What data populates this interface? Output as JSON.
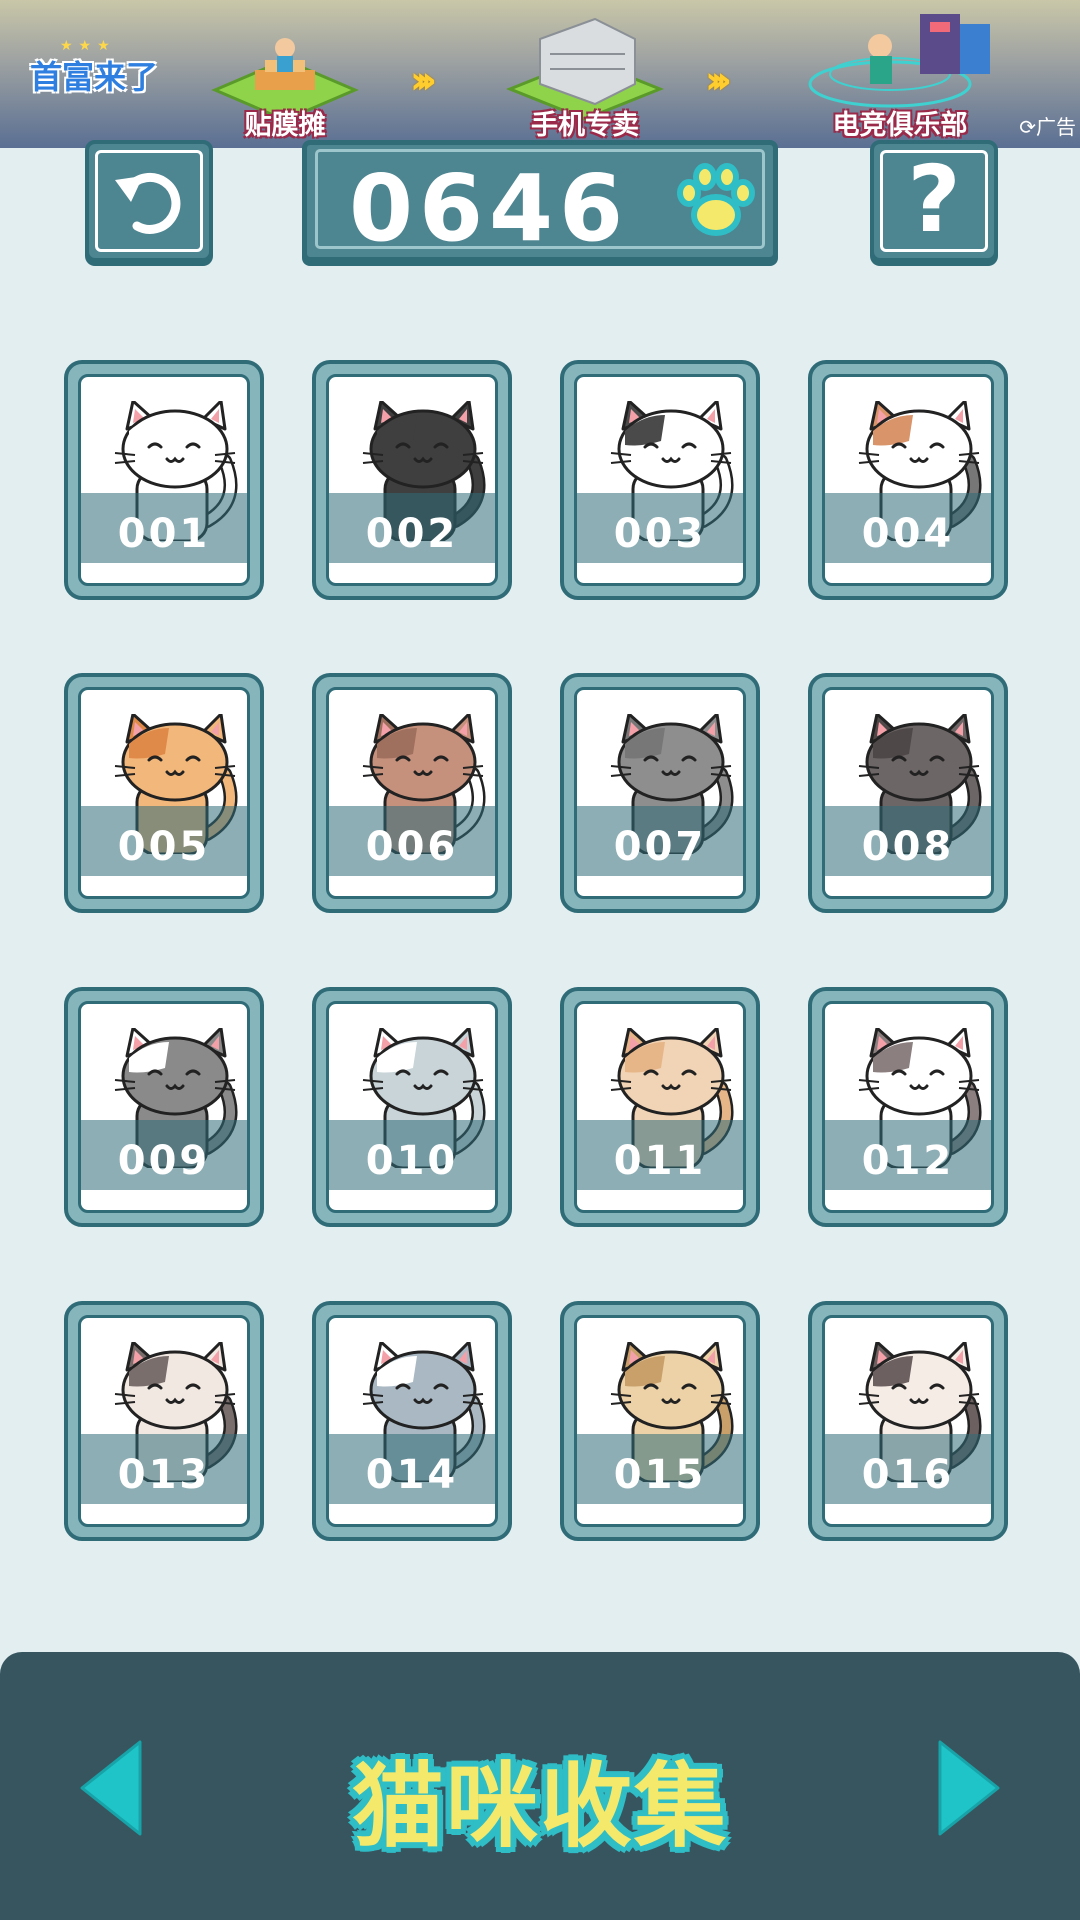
{
  "ad": {
    "logo": "首富来了",
    "stages": [
      "贴膜摊",
      "手机专卖",
      "电竞俱乐部"
    ],
    "arrow": "›››",
    "tag": "⟳广告"
  },
  "top_bar": {
    "paw_count": "0646",
    "help_label": "?",
    "undo_glyph": "↺"
  },
  "cats": [
    {
      "id": "001",
      "body": "#ffffff",
      "accent": "#ffffff",
      "tail": "#ffffff"
    },
    {
      "id": "002",
      "body": "#3f3f3f",
      "accent": "#3f3f3f",
      "tail": "#3f3f3f"
    },
    {
      "id": "003",
      "body": "#ffffff",
      "accent": "#4a4a4a",
      "tail": "#ffffff"
    },
    {
      "id": "004",
      "body": "#ffffff",
      "accent": "#d9946a",
      "tail": "#777777"
    },
    {
      "id": "005",
      "body": "#f2b77a",
      "accent": "#e08a4a",
      "tail": "#f2b77a"
    },
    {
      "id": "006",
      "body": "#c6917c",
      "accent": "#a0705e",
      "tail": "#ffffff"
    },
    {
      "id": "007",
      "body": "#8e8e8e",
      "accent": "#777777",
      "tail": "#8e8e8e"
    },
    {
      "id": "008",
      "body": "#6d6666",
      "accent": "#4f4848",
      "tail": "#6d6666"
    },
    {
      "id": "009",
      "body": "#8a8a8a",
      "accent": "#ffffff",
      "tail": "#8a8a8a"
    },
    {
      "id": "010",
      "body": "#c8d4d8",
      "accent": "#ffffff",
      "tail": "#c8d4d8"
    },
    {
      "id": "011",
      "body": "#f1d3b5",
      "accent": "#e7b688",
      "tail": "#e7b688"
    },
    {
      "id": "012",
      "body": "#ffffff",
      "accent": "#8c7f7f",
      "tail": "#8c7f7f"
    },
    {
      "id": "013",
      "body": "#f2e8e2",
      "accent": "#7a6e6c",
      "tail": "#7a6e6c"
    },
    {
      "id": "014",
      "body": "#a9b8c2",
      "accent": "#ffffff",
      "tail": "#a9b8c2"
    },
    {
      "id": "015",
      "body": "#ecd2a6",
      "accent": "#c9a06a",
      "tail": "#c9a06a"
    },
    {
      "id": "016",
      "body": "#f5ece6",
      "accent": "#6d6060",
      "tail": "#6d6060"
    }
  ],
  "footer": {
    "title": "猫咪收集",
    "prev_glyph": "◀",
    "next_glyph": "▶"
  },
  "colors": {
    "teal_dark": "#2f6c78",
    "teal": "#4d8591",
    "background": "#e2eef0",
    "footer": "#37555f",
    "paw": "#f5e96b",
    "arrow": "#1fc4c8"
  }
}
